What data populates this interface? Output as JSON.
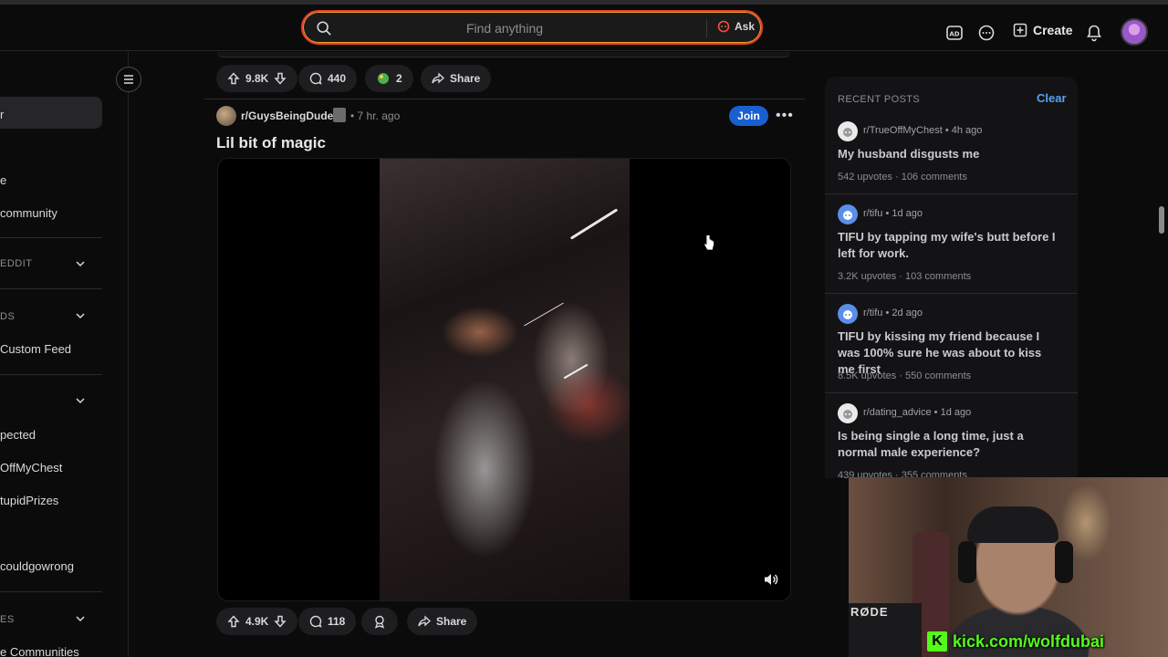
{
  "search": {
    "placeholder": "Find anything",
    "ask_label": "Ask"
  },
  "header": {
    "create_label": "Create"
  },
  "sidebar": {
    "items": [
      {
        "label": "r",
        "top": 0
      },
      {
        "label": "e"
      },
      {
        "label": "community"
      },
      {
        "label": "Custom Feed"
      },
      {
        "label": "pected"
      },
      {
        "label": "OffMyChest"
      },
      {
        "label": "tupidPrizes"
      },
      {
        "label": "couldgowrong"
      },
      {
        "label": "e Communities"
      }
    ],
    "sections": [
      "EDDIT",
      "DS",
      "",
      "ES"
    ]
  },
  "prev_post": {
    "upvotes": "9.8K",
    "comments": "440",
    "awards": "2",
    "share_label": "Share"
  },
  "post": {
    "subreddit": "r/GuysBeingDudes",
    "time": "• 7 hr. ago",
    "join_label": "Join",
    "title": "Lil bit of magic",
    "upvotes": "4.9K",
    "comments": "118",
    "share_label": "Share"
  },
  "recent": {
    "header": "RECENT POSTS",
    "clear_label": "Clear",
    "posts": [
      {
        "sub": "r/TrueOffMyChest",
        "time": "• 4h ago",
        "title": "My husband disgusts me",
        "upvotes": "542 upvotes",
        "comments": "106 comments"
      },
      {
        "sub": "r/tifu",
        "time": "• 1d ago",
        "title": "TIFU by tapping my wife's butt before I left for work.",
        "upvotes": "3.2K upvotes",
        "comments": "103 comments"
      },
      {
        "sub": "r/tifu",
        "time": "• 2d ago",
        "title": "TIFU by kissing my friend because I was 100% sure he was about to kiss me first",
        "upvotes": "8.5K upvotes",
        "comments": "550 comments"
      },
      {
        "sub": "r/dating_advice",
        "time": "• 1d ago",
        "title": "Is being single a long time, just a normal male experience?",
        "upvotes": "439 upvotes",
        "comments": "355 comments"
      }
    ]
  },
  "webcam": {
    "mic_brand": "RØDE",
    "kick_url": "kick.com/wolfdubai"
  },
  "colors": {
    "accent_blue": "#1a5fd0",
    "link_blue": "#5aa0f0",
    "kick_green": "#53fc18",
    "search_border": "#e8422a"
  }
}
